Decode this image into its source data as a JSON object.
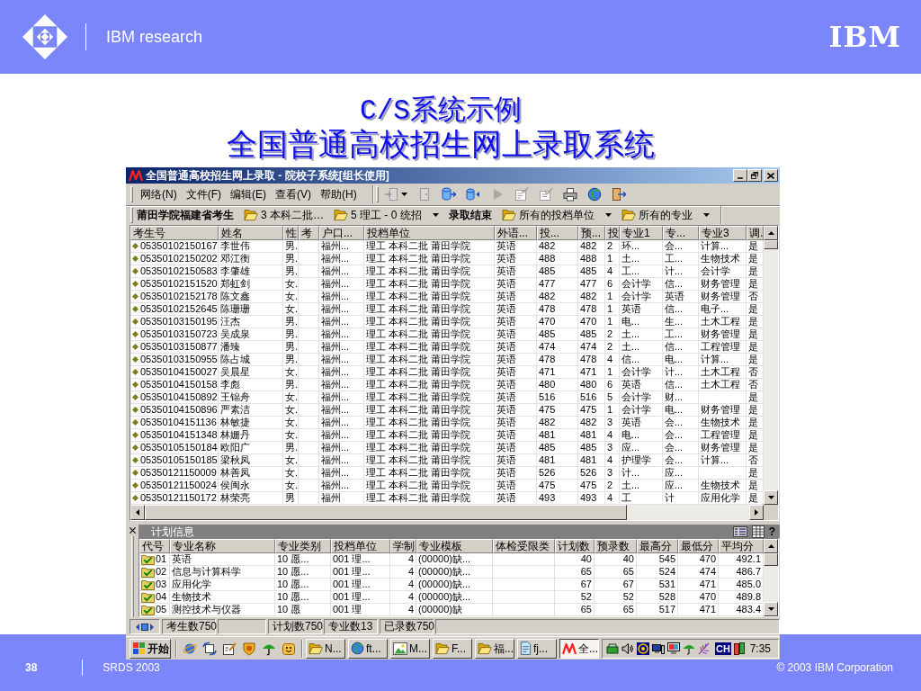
{
  "header": {
    "brand": "IBM research",
    "logo_text": "IBM"
  },
  "title": {
    "line_1": "C/S系统示例",
    "line_2": "全国普通高校招生网上录取系统"
  },
  "app": {
    "window_title": "全国普通高校招生网上录取 - 院校子系统[组长使用]",
    "menu": [
      "网络(N)",
      "文件(F)",
      "编辑(E)",
      "查看(V)",
      "帮助(H)"
    ],
    "toolbar": [
      {
        "kind": "import",
        "disabled": true,
        "dropdown": true
      },
      {
        "kind": "door",
        "disabled": true
      },
      {
        "kind": "load",
        "disabled": false
      },
      {
        "kind": "send",
        "disabled": false
      },
      {
        "kind": "play",
        "disabled": true
      },
      {
        "kind": "checklist",
        "disabled": true
      },
      {
        "kind": "approve",
        "disabled": true
      },
      {
        "kind": "print",
        "disabled": false
      },
      {
        "kind": "web",
        "disabled": false
      },
      {
        "kind": "exit",
        "disabled": false
      }
    ],
    "filter_bar": [
      {
        "kind": "label",
        "text": "莆田学院福建省考生"
      },
      {
        "kind": "folder",
        "text": "3 本科二批…",
        "dropdown": false
      },
      {
        "kind": "folder",
        "text": "5 理工 - 0 统招",
        "dropdown": true
      },
      {
        "kind": "label",
        "text": "录取结束"
      },
      {
        "kind": "folder",
        "text": "所有的投档单位",
        "dropdown": true
      },
      {
        "kind": "folder",
        "text": "所有的专业",
        "dropdown": true
      }
    ],
    "students_table": {
      "columns": [
        "考生号",
        "姓名",
        "性",
        "考",
        "户口...",
        "投档单位",
        "外语...",
        "投...",
        "预...",
        "投",
        "专业1",
        "专...",
        "专业3",
        "调."
      ],
      "rows": [
        {
          "student_no": "05350102150167",
          "name": "李世伟",
          "sex": "男.",
          "hukou": "福州...",
          "unit": "理工 本科二批 莆田学院",
          "language": "英语",
          "column_8": "482",
          "column_9": "482",
          "column_10": "2",
          "major_1": "环...",
          "column_12": "会...",
          "major_3": "计算...",
          "column_14": "是"
        },
        {
          "student_no": "05350102150202",
          "name": "邓江衡",
          "sex": "男.",
          "hukou": "福州...",
          "unit": "理工 本科二批 莆田学院",
          "language": "英语",
          "column_8": "488",
          "column_9": "488",
          "column_10": "1",
          "major_1": "土...",
          "column_12": "工...",
          "major_3": "生物技术",
          "column_14": "是"
        },
        {
          "student_no": "05350102150583",
          "name": "李肇雄",
          "sex": "男.",
          "hukou": "福州...",
          "unit": "理工 本科二批 莆田学院",
          "language": "英语",
          "column_8": "485",
          "column_9": "485",
          "column_10": "4",
          "major_1": "工...",
          "column_12": "计...",
          "major_3": "会计学",
          "column_14": "是"
        },
        {
          "student_no": "05350102151520",
          "name": "郑虹剑",
          "sex": "女.",
          "hukou": "福州...",
          "unit": "理工 本科二批 莆田学院",
          "language": "英语",
          "column_8": "477",
          "column_9": "477",
          "column_10": "6",
          "major_1": "会计学",
          "column_12": "信...",
          "major_3": "财务管理",
          "column_14": "是"
        },
        {
          "student_no": "05350102152178",
          "name": "陈文鑫",
          "sex": "女.",
          "hukou": "福州...",
          "unit": "理工 本科二批 莆田学院",
          "language": "英语",
          "column_8": "482",
          "column_9": "482",
          "column_10": "1",
          "major_1": "会计学",
          "column_12": "英语",
          "major_3": "财务管理",
          "column_14": "否"
        },
        {
          "student_no": "05350102152645",
          "name": "陈珊珊",
          "sex": "女.",
          "hukou": "福州...",
          "unit": "理工 本科二批 莆田学院",
          "language": "英语",
          "column_8": "478",
          "column_9": "478",
          "column_10": "1",
          "major_1": "英语",
          "column_12": "信...",
          "major_3": "电子...",
          "column_14": "是"
        },
        {
          "student_no": "05350103150195",
          "name": "汪杰",
          "sex": "男.",
          "hukou": "福州...",
          "unit": "理工 本科二批 莆田学院",
          "language": "英语",
          "column_8": "470",
          "column_9": "470",
          "column_10": "1",
          "major_1": "电...",
          "column_12": "生...",
          "major_3": "土木工程",
          "column_14": "是"
        },
        {
          "student_no": "05350103150723",
          "name": "吴成泉",
          "sex": "男.",
          "hukou": "福州...",
          "unit": "理工 本科二批 莆田学院",
          "language": "英语",
          "column_8": "485",
          "column_9": "485",
          "column_10": "2",
          "major_1": "土...",
          "column_12": "工...",
          "major_3": "财务管理",
          "column_14": "是"
        },
        {
          "student_no": "05350103150877",
          "name": "潘臻",
          "sex": "男.",
          "hukou": "福州...",
          "unit": "理工 本科二批 莆田学院",
          "language": "英语",
          "column_8": "474",
          "column_9": "474",
          "column_10": "2",
          "major_1": "土...",
          "column_12": "信...",
          "major_3": "工程管理",
          "column_14": "是"
        },
        {
          "student_no": "05350103150955",
          "name": "陈占城",
          "sex": "男.",
          "hukou": "福州...",
          "unit": "理工 本科二批 莆田学院",
          "language": "英语",
          "column_8": "478",
          "column_9": "478",
          "column_10": "4",
          "major_1": "信...",
          "column_12": "电...",
          "major_3": "计算...",
          "column_14": "是"
        },
        {
          "student_no": "05350104150027",
          "name": "吴晨星",
          "sex": "女.",
          "hukou": "福州...",
          "unit": "理工 本科二批 莆田学院",
          "language": "英语",
          "column_8": "471",
          "column_9": "471",
          "column_10": "1",
          "major_1": "会计学",
          "column_12": "计...",
          "major_3": "土木工程",
          "column_14": "否"
        },
        {
          "student_no": "05350104150158",
          "name": "李彪",
          "sex": "男.",
          "hukou": "福州...",
          "unit": "理工 本科二批 莆田学院",
          "language": "英语",
          "column_8": "480",
          "column_9": "480",
          "column_10": "6",
          "major_1": "英语",
          "column_12": "信...",
          "major_3": "土木工程",
          "column_14": "否"
        },
        {
          "student_no": "05350104150892",
          "name": "王锦舟",
          "sex": "女.",
          "hukou": "福州...",
          "unit": "理工 本科二批 莆田学院",
          "language": "英语",
          "column_8": "516",
          "column_9": "516",
          "column_10": "5",
          "major_1": "会计学",
          "column_12": "财...",
          "column_14": "是"
        },
        {
          "student_no": "05350104150896",
          "name": "严素洁",
          "sex": "女.",
          "hukou": "福州...",
          "unit": "理工 本科二批 莆田学院",
          "language": "英语",
          "column_8": "475",
          "column_9": "475",
          "column_10": "1",
          "major_1": "会计学",
          "column_12": "电...",
          "major_3": "财务管理",
          "column_14": "是"
        },
        {
          "student_no": "05350104151136",
          "name": "林敏捷",
          "sex": "女.",
          "hukou": "福州...",
          "unit": "理工 本科二批 莆田学院",
          "language": "英语",
          "column_8": "482",
          "column_9": "482",
          "column_10": "3",
          "major_1": "英语",
          "column_12": "会...",
          "major_3": "生物技术",
          "column_14": "是"
        },
        {
          "student_no": "05350104151348",
          "name": "林姗丹",
          "sex": "女.",
          "hukou": "福州...",
          "unit": "理工 本科二批 莆田学院",
          "language": "英语",
          "column_8": "481",
          "column_9": "481",
          "column_10": "4",
          "major_1": "电...",
          "column_12": "会...",
          "major_3": "工程管理",
          "column_14": "是"
        },
        {
          "student_no": "05350105150184",
          "name": "欧阳广",
          "sex": "男.",
          "hukou": "福州...",
          "unit": "理工 本科二批 莆田学院",
          "language": "英语",
          "column_8": "485",
          "column_9": "485",
          "column_10": "3",
          "major_1": "应...",
          "column_12": "会...",
          "major_3": "财务管理",
          "column_14": "是"
        },
        {
          "student_no": "05350105150185",
          "name": "梁秋凤",
          "sex": "女.",
          "hukou": "福州...",
          "unit": "理工 本科二批 莆田学院",
          "language": "英语",
          "column_8": "481",
          "column_9": "481",
          "column_10": "4",
          "major_1": "护理学",
          "column_12": "会...",
          "major_3": "计算...",
          "column_14": "否"
        },
        {
          "student_no": "05350121150009",
          "name": "林善凤",
          "sex": "女.",
          "hukou": "福州...",
          "unit": "理工 本科二批 莆田学院",
          "language": "英语",
          "column_8": "526",
          "column_9": "526",
          "column_10": "3",
          "major_1": "计...",
          "column_12": "应...",
          "column_14": "是"
        },
        {
          "student_no": "05350121150024",
          "name": "侯闽永",
          "sex": "女.",
          "hukou": "福州...",
          "unit": "理工 本科二批 莆田学院",
          "language": "英语",
          "column_8": "475",
          "column_9": "475",
          "column_10": "2",
          "major_1": "土...",
          "column_12": "应...",
          "major_3": "生物技术",
          "column_14": "是"
        },
        {
          "student_no": "05350121150172",
          "name": "林荣亮",
          "sex": "男",
          "hukou": "福州",
          "unit": "理工 本科二批 莆田学院",
          "language": "英语",
          "column_8": "493",
          "column_9": "493",
          "column_10": "4",
          "major_1": "工",
          "column_12": "计",
          "major_3": "应用化学",
          "column_14": "是"
        }
      ]
    },
    "plan_panel": {
      "title": "计划信息",
      "help": "?",
      "columns": [
        "代号",
        "专业名称",
        "专业类别",
        "投档单位",
        "学制",
        "专业模板",
        "体检受限类",
        "计划数",
        "预录数",
        "最高分",
        "最低分",
        "平均分"
      ],
      "rows": [
        {
          "code": "01",
          "major": "英语",
          "category": "10 愿...",
          "unit": "001 理...",
          "years": "4",
          "template": "(00000)缺...",
          "plan": "40",
          "pre_admitted": "40",
          "max": "545",
          "min": "470",
          "avg": "492.1"
        },
        {
          "code": "02",
          "major": "信息与计算科学",
          "category": "10 愿...",
          "unit": "001 理...",
          "years": "4",
          "template": "(00000)缺...",
          "plan": "65",
          "pre_admitted": "65",
          "max": "524",
          "min": "474",
          "avg": "486.7"
        },
        {
          "code": "03",
          "major": "应用化学",
          "category": "10 愿...",
          "unit": "001 理...",
          "years": "4",
          "template": "(00000)缺...",
          "plan": "67",
          "pre_admitted": "67",
          "max": "531",
          "min": "471",
          "avg": "485.0"
        },
        {
          "code": "04",
          "major": "生物技术",
          "category": "10 愿...",
          "unit": "001 理...",
          "years": "4",
          "template": "(00000)缺...",
          "plan": "52",
          "pre_admitted": "52",
          "max": "528",
          "min": "470",
          "avg": "489.8"
        },
        {
          "code": "05",
          "major": "测控技术与仪器",
          "category": "10 愿",
          "unit": "001 理",
          "years": "4",
          "template": "(00000)缺",
          "plan": "65",
          "pre_admitted": "65",
          "max": "517",
          "min": "471",
          "avg": "483.4"
        }
      ]
    },
    "status_bar": {
      "left": [
        "考生数750"
      ],
      "right": [
        "计划数750",
        "专业数13",
        "已录数750"
      ]
    }
  },
  "taskbar": {
    "start": "开始",
    "tasks": [
      {
        "label": "N...",
        "kind": "folder",
        "selected": false
      },
      {
        "label": "ft...",
        "kind": "web",
        "selected": false
      },
      {
        "label": "M...",
        "kind": "image",
        "selected": false
      },
      {
        "label": "F...",
        "kind": "folder",
        "selected": false
      },
      {
        "label": "福...",
        "kind": "folder",
        "selected": false
      },
      {
        "label": "fj...",
        "kind": "document",
        "selected": false
      },
      {
        "label": "全...",
        "kind": "app",
        "selected": true
      }
    ],
    "ime": "CH",
    "clock": "7:35"
  },
  "footer": {
    "page": "38",
    "event": "SRDS 2003",
    "copyright": "© 2003 IBM Corporation"
  }
}
